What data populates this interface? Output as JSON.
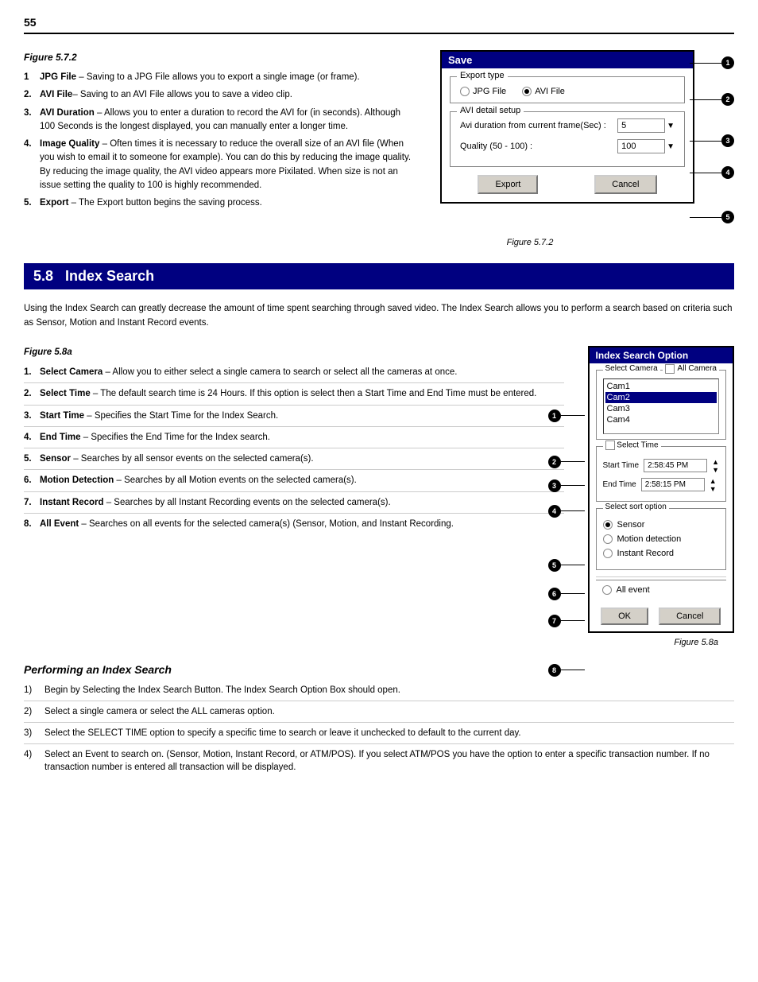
{
  "page": {
    "number": "55",
    "top_section": {
      "figure_label": "Figure 5.7.2",
      "items": [
        {
          "num": "1",
          "term": "JPG File",
          "desc": "– Saving to a JPG File allows you to export a single image (or frame)."
        },
        {
          "num": "2",
          "term": "AVI File",
          "desc": "– Saving to an AVI File allows you to save a video clip."
        },
        {
          "num": "3",
          "term": "AVI Duration",
          "desc": "– Allows you to enter a duration to record the AVI for (in seconds). Although 100 Seconds is the longest displayed, you can manually enter a longer time."
        },
        {
          "num": "4",
          "term": "Image Quality",
          "desc": "– Often times it is necessary to reduce the overall size of an AVI file (When you wish to email it to someone for example). You can do this by reducing the image quality. By reducing the image quality, the AVI video appears more Pixilated. When size is not an issue setting the quality to 100 is highly recommended."
        },
        {
          "num": "5",
          "term": "Export",
          "desc": "– The Export button begins the saving process."
        }
      ]
    },
    "save_dialog": {
      "title": "Save",
      "export_type_label": "Export type",
      "jpg_file_label": "JPG File",
      "avi_file_label": "AVI File",
      "avi_detail_label": "AVI detail setup",
      "duration_label": "Avi duration from current frame(Sec) :",
      "duration_value": "5",
      "quality_label": "Quality (50 - 100) :",
      "quality_value": "100",
      "export_btn": "Export",
      "cancel_btn": "Cancel"
    },
    "section_58": {
      "number": "5.8",
      "title": "Index Search",
      "intro": "Using the Index Search can greatly decrease the amount of time spent searching through saved video. The Index Search allows you to perform a search based on criteria such as Sensor, Motion and Instant Record events.",
      "figure_label": "Figure 5.8a",
      "items": [
        {
          "num": "1",
          "term": "Select Camera",
          "desc": "– Allow you to either select a single camera to search or select all the cameras at once."
        },
        {
          "num": "2",
          "term": "Select Time",
          "desc": "– The default search time is 24 Hours.  If this option is select then a Start Time and End Time must be entered."
        },
        {
          "num": "3",
          "term": "Start Time",
          "desc": "– Specifies the Start Time for the Index Search."
        },
        {
          "num": "4",
          "term": "End Time",
          "desc": "– Specifies the End Time for the Index search."
        },
        {
          "num": "5",
          "term": "Sensor",
          "desc": "– Searches by all sensor events on the selected camera(s)."
        },
        {
          "num": "6",
          "term": "Motion Detection",
          "desc": "– Searches by all Motion events on the selected camera(s)."
        },
        {
          "num": "7",
          "term": "Instant Record",
          "desc": "– Searches by all Instant Recording events on the selected camera(s)."
        },
        {
          "num": "8",
          "term": "All Event",
          "desc": "– Searches on all events for the selected camera(s) (Sensor, Motion, and Instant Recording."
        }
      ],
      "index_dialog": {
        "title": "Index Search Option",
        "select_camera_label": "Select Camera",
        "all_camera_label": "All Camera",
        "cameras": [
          "Cam1",
          "Cam2",
          "Cam3",
          "Cam4"
        ],
        "selected_camera": "Cam2",
        "select_time_label": "Select Time",
        "start_time_label": "Start Time",
        "start_time_value": "2:58:45 PM",
        "end_time_label": "End Time",
        "end_time_value": "2:58:15 PM",
        "sort_label": "Select sort option",
        "sensor_label": "Sensor",
        "motion_label": "Motion detection",
        "instant_label": "Instant Record",
        "all_event_label": "All event",
        "ok_btn": "OK",
        "cancel_btn": "Cancel"
      },
      "performing": {
        "title": "Performing an Index Search",
        "steps": [
          {
            "num": "1)",
            "desc": "Begin by Selecting the Index Search Button. The Index Search Option Box should open."
          },
          {
            "num": "2)",
            "desc": "Select a single camera or select the ALL cameras option."
          },
          {
            "num": "3)",
            "desc": "Select the SELECT TIME option to specify a specific time to search or leave it unchecked to default to the current day."
          },
          {
            "num": "4)",
            "desc": "Select an Event to search on. (Sensor, Motion, Instant Record, or ATM/POS). If you select ATM/POS you have the option to enter a specific transaction number. If no transaction number is entered all transaction will be displayed."
          }
        ]
      }
    }
  }
}
